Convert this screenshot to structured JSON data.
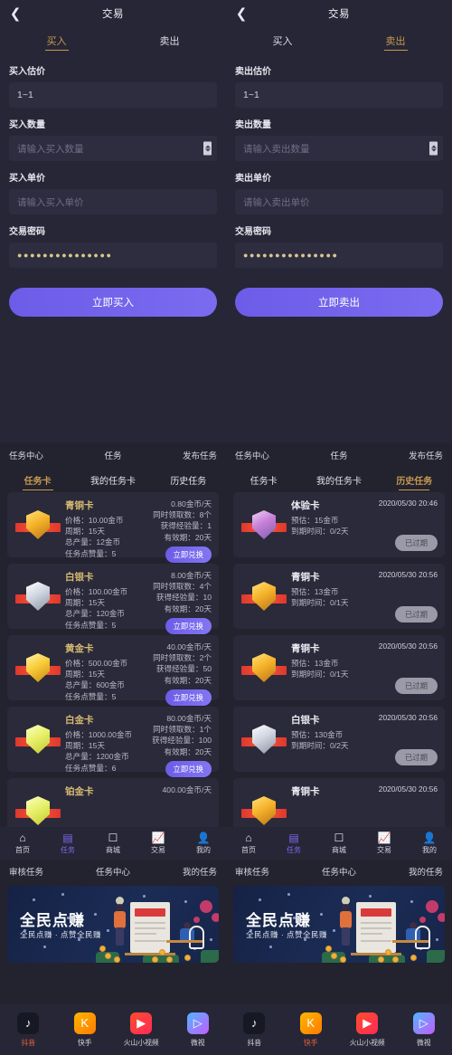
{
  "trade_panels": [
    {
      "back_icon": "chevron-left-icon",
      "title": "交易",
      "tabs": [
        {
          "label": "买入",
          "active": true
        },
        {
          "label": "卖出",
          "active": false
        }
      ],
      "fields": [
        {
          "label": "买入估价",
          "value": "1~1",
          "placeholder": "",
          "is_placeholder": false,
          "stepper": false,
          "password": false
        },
        {
          "label": "买入数量",
          "value": "",
          "placeholder": "请输入买入数量",
          "is_placeholder": true,
          "stepper": true,
          "password": false
        },
        {
          "label": "买入单价",
          "value": "",
          "placeholder": "请输入买入单价",
          "is_placeholder": true,
          "stepper": false,
          "password": false
        },
        {
          "label": "交易密码",
          "value": "●●●●●●●●●●●●●●●",
          "placeholder": "",
          "is_placeholder": false,
          "stepper": false,
          "password": true
        }
      ],
      "submit_label": "立即买入"
    },
    {
      "back_icon": "chevron-left-icon",
      "title": "交易",
      "tabs": [
        {
          "label": "买入",
          "active": false
        },
        {
          "label": "卖出",
          "active": true
        }
      ],
      "fields": [
        {
          "label": "卖出估价",
          "value": "1~1",
          "placeholder": "",
          "is_placeholder": false,
          "stepper": false,
          "password": false
        },
        {
          "label": "卖出数量",
          "value": "",
          "placeholder": "请输入卖出数量",
          "is_placeholder": true,
          "stepper": true,
          "password": false
        },
        {
          "label": "卖出单价",
          "value": "",
          "placeholder": "请输入卖出单价",
          "is_placeholder": true,
          "stepper": false,
          "password": false
        },
        {
          "label": "交易密码",
          "value": "●●●●●●●●●●●●●●●",
          "placeholder": "",
          "is_placeholder": false,
          "stepper": false,
          "password": true
        }
      ],
      "submit_label": "立即卖出"
    }
  ],
  "task_panels": [
    {
      "header": [
        "任务中心",
        "任务",
        "发布任务"
      ],
      "tabs": [
        {
          "label": "任务卡",
          "active": true
        },
        {
          "label": "我的任务卡",
          "active": false
        },
        {
          "label": "历史任务",
          "active": false
        }
      ],
      "cards": [
        {
          "name": "青铜卡",
          "badge": "bronze",
          "lines": [
            "价格：10.00金币",
            "周期：15天",
            "总产量：12金币",
            "任务点赞量：5"
          ],
          "right_lines": [
            "0.80金币/天",
            "同时领取数：8个",
            "获得经验量：1",
            "有效期：20天"
          ],
          "action": "立即兑换",
          "action_state": "active"
        },
        {
          "name": "白银卡",
          "badge": "silver",
          "lines": [
            "价格：100.00金币",
            "周期：15天",
            "总产量：120金币",
            "任务点赞量：5"
          ],
          "right_lines": [
            "8.00金币/天",
            "同时领取数：4个",
            "获得经验量：10",
            "有效期：20天"
          ],
          "action": "立即兑换",
          "action_state": "active"
        },
        {
          "name": "黄金卡",
          "badge": "gold",
          "lines": [
            "价格：500.00金币",
            "周期：15天",
            "总产量：600金币",
            "任务点赞量：5"
          ],
          "right_lines": [
            "40.00金币/天",
            "同时领取数：2个",
            "获得经验量：50",
            "有效期：20天"
          ],
          "action": "立即兑换",
          "action_state": "active"
        },
        {
          "name": "白金卡",
          "badge": "platinum",
          "lines": [
            "价格：1000.00金币",
            "周期：15天",
            "总产量：1200金币",
            "任务点赞量：6"
          ],
          "right_lines": [
            "80.00金币/天",
            "同时领取数：1个",
            "获得经验量：100",
            "有效期：20天"
          ],
          "action": "立即兑换",
          "action_state": "active"
        },
        {
          "name": "铂金卡",
          "badge": "platinum",
          "lines": [],
          "right_lines": [
            "400.00金币/天"
          ],
          "action": "",
          "action_state": "none"
        }
      ]
    },
    {
      "header": [
        "任务中心",
        "任务",
        "发布任务"
      ],
      "tabs": [
        {
          "label": "任务卡",
          "active": false
        },
        {
          "label": "我的任务卡",
          "active": false
        },
        {
          "label": "历史任务",
          "active": true
        }
      ],
      "cards": [
        {
          "name": "体验卡",
          "badge": "exp",
          "lines": [
            "预估：15金币",
            "到期时间：0/2天"
          ],
          "date": "2020/05/30 20:46",
          "action": "已过期",
          "action_state": "expired"
        },
        {
          "name": "青铜卡",
          "badge": "bronze",
          "lines": [
            "预估：13金币",
            "到期时间：0/1天"
          ],
          "date": "2020/05/30 20:56",
          "action": "已过期",
          "action_state": "expired"
        },
        {
          "name": "青铜卡",
          "badge": "bronze",
          "lines": [
            "预估：13金币",
            "到期时间：0/1天"
          ],
          "date": "2020/05/30 20:56",
          "action": "已过期",
          "action_state": "expired"
        },
        {
          "name": "白银卡",
          "badge": "silver",
          "lines": [
            "预估：130金币",
            "到期时间：0/2天"
          ],
          "date": "2020/05/30 20:56",
          "action": "已过期",
          "action_state": "expired"
        },
        {
          "name": "青铜卡",
          "badge": "bronze",
          "lines": [],
          "date": "2020/05/30 20:56",
          "action": "",
          "action_state": "none"
        }
      ]
    }
  ],
  "tabbar": {
    "items": [
      {
        "label": "首页",
        "icon": "home-icon",
        "glyph": "⌂",
        "active": false
      },
      {
        "label": "任务",
        "icon": "task-list-icon",
        "glyph": "▤",
        "active": true
      },
      {
        "label": "商城",
        "icon": "shop-bag-icon",
        "glyph": "☐",
        "active": false
      },
      {
        "label": "交易",
        "icon": "trend-chart-icon",
        "glyph": "📈",
        "active": false
      },
      {
        "label": "我的",
        "icon": "user-profile-icon",
        "glyph": "👤",
        "active": false
      }
    ]
  },
  "review_panels": [
    {
      "header": [
        "审核任务",
        "任务中心",
        "我的任务"
      ],
      "banner": {
        "title": "全民点赚",
        "subtitle": "全民点赚 · 点赞全民赚",
        "board_label": "全民点赚"
      },
      "apps": [
        {
          "name": "抖音",
          "icon": "douyin-icon",
          "glyph": "♪",
          "active": true
        },
        {
          "name": "快手",
          "icon": "kuaishou-icon",
          "glyph": "K",
          "active": false
        },
        {
          "name": "火山小视频",
          "icon": "huoshan-icon",
          "glyph": "▶",
          "active": false
        },
        {
          "name": "微视",
          "icon": "weishi-icon",
          "glyph": "▷",
          "active": false
        }
      ]
    },
    {
      "header": [
        "审核任务",
        "任务中心",
        "我的任务"
      ],
      "banner": {
        "title": "全民点赚",
        "subtitle": "全民点赚 · 点赞全民赚",
        "board_label": "全民点赚"
      },
      "apps": [
        {
          "name": "抖音",
          "icon": "douyin-icon",
          "glyph": "♪",
          "active": false
        },
        {
          "name": "快手",
          "icon": "kuaishou-icon",
          "glyph": "K",
          "active": true
        },
        {
          "name": "火山小视频",
          "icon": "huoshan-icon",
          "glyph": "▶",
          "active": false
        },
        {
          "name": "微视",
          "icon": "weishi-icon",
          "glyph": "▷",
          "active": false
        }
      ]
    }
  ],
  "colors": {
    "page_bg": "#1b1b2a",
    "panel_bg": "#272636",
    "card_bg": "#2b2a3a",
    "accent_gold": "#c79a4e",
    "accent_purple": "#6c5ce7",
    "expired_gray": "#9a9aa8",
    "app_active": "#e8623c"
  }
}
